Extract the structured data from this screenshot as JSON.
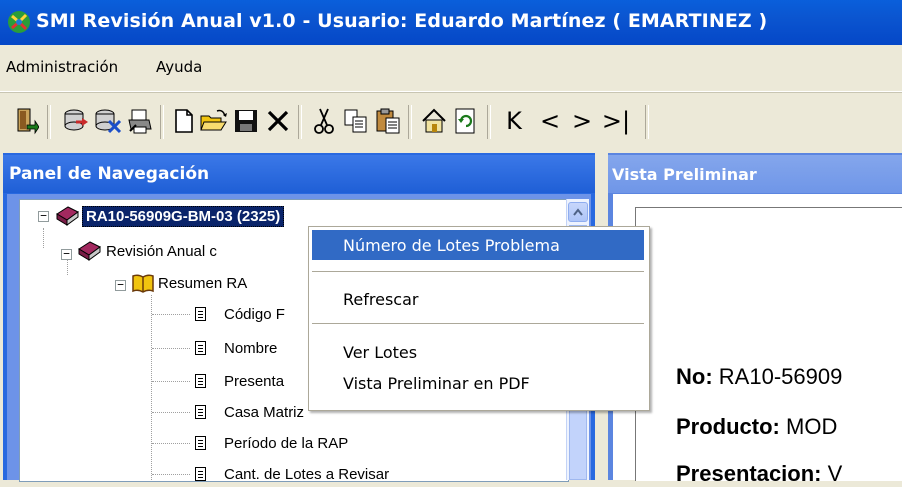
{
  "window": {
    "title": "SMI Revisión Anual v1.0 - Usuario: Eduardo Martínez ( EMARTINEZ )",
    "icon": "app-logo-icon"
  },
  "menubar": {
    "items": [
      {
        "label": "Administración"
      },
      {
        "label": "Ayuda"
      }
    ]
  },
  "toolbar": {
    "buttons": [
      {
        "name": "exit-icon"
      },
      {
        "name": "connect-icon"
      },
      {
        "name": "disconnect-icon"
      },
      {
        "name": "print-setup-icon"
      },
      {
        "name": "new-document-icon"
      },
      {
        "name": "open-folder-icon"
      },
      {
        "name": "save-icon"
      },
      {
        "name": "delete-icon"
      },
      {
        "name": "cut-icon"
      },
      {
        "name": "copy-icon"
      },
      {
        "name": "paste-icon"
      },
      {
        "name": "home-icon"
      },
      {
        "name": "refresh-icon"
      },
      {
        "name": "first-record-icon",
        "glyph": "K"
      },
      {
        "name": "previous-record-icon",
        "glyph": "<"
      },
      {
        "name": "next-record-icon",
        "glyph": ">"
      },
      {
        "name": "last-record-icon",
        "glyph": ">|"
      }
    ]
  },
  "nav_panel": {
    "title": "Panel de Navegación",
    "tree": {
      "root": "RA10-56909G-BM-03 (2325)",
      "level1": "Revisión Anual c",
      "level2": "Resumen RA",
      "leaves": [
        "Código F",
        "Nombre",
        "Presenta",
        "Casa Matriz",
        "Período de la RAP",
        "Cant. de Lotes a Revisar"
      ]
    }
  },
  "vista_panel": {
    "title": "Vista Preliminar",
    "fields": [
      {
        "label": "No:",
        "value": "RA10-56909"
      },
      {
        "label": "Producto:",
        "value": "MOD"
      },
      {
        "label": "Presentacion:",
        "value": "V"
      }
    ]
  },
  "context_menu": {
    "items": [
      {
        "label": "Número de Lotes Problema",
        "active": true
      },
      {
        "label": "Refrescar"
      },
      {
        "label": "Ver Lotes"
      },
      {
        "label": "Vista Preliminar en PDF"
      }
    ]
  },
  "colors": {
    "titlebar": "#0b55d0",
    "selection": "#316ac5",
    "panel_header": "#2969e0"
  }
}
